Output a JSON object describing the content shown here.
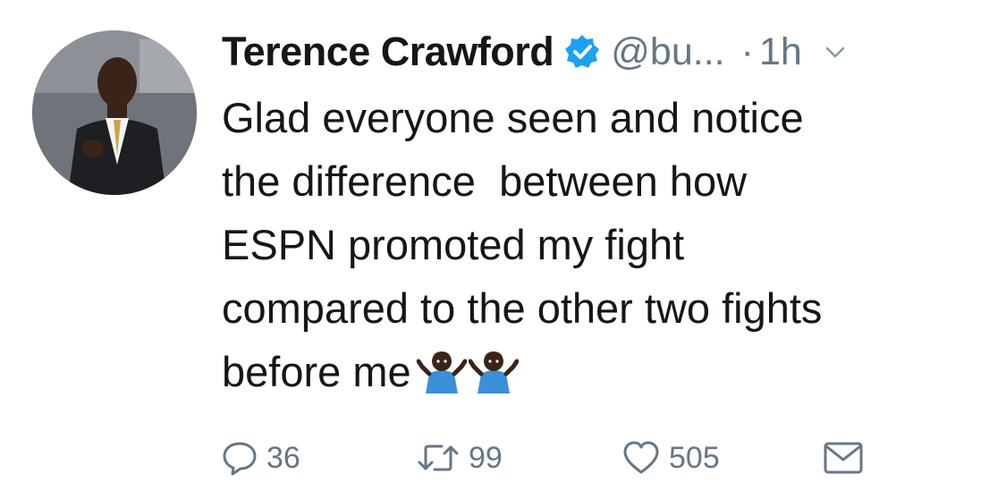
{
  "tweet": {
    "author_name": "Terence Crawford",
    "author_handle": "@bu...",
    "separator": "·",
    "time_ago": "1h",
    "text_lines": [
      "Glad everyone seen and notice",
      "the difference  between how",
      "ESPN promoted my fight",
      "compared to the other two fights",
      "before me"
    ],
    "emoji": [
      "person-shrugging-emoji",
      "person-shrugging-emoji"
    ],
    "replies": "36",
    "retweets": "99",
    "likes": "505"
  },
  "colors": {
    "text": "#14171a",
    "secondary": "#657786",
    "verified_blue": "#1da1f2"
  }
}
